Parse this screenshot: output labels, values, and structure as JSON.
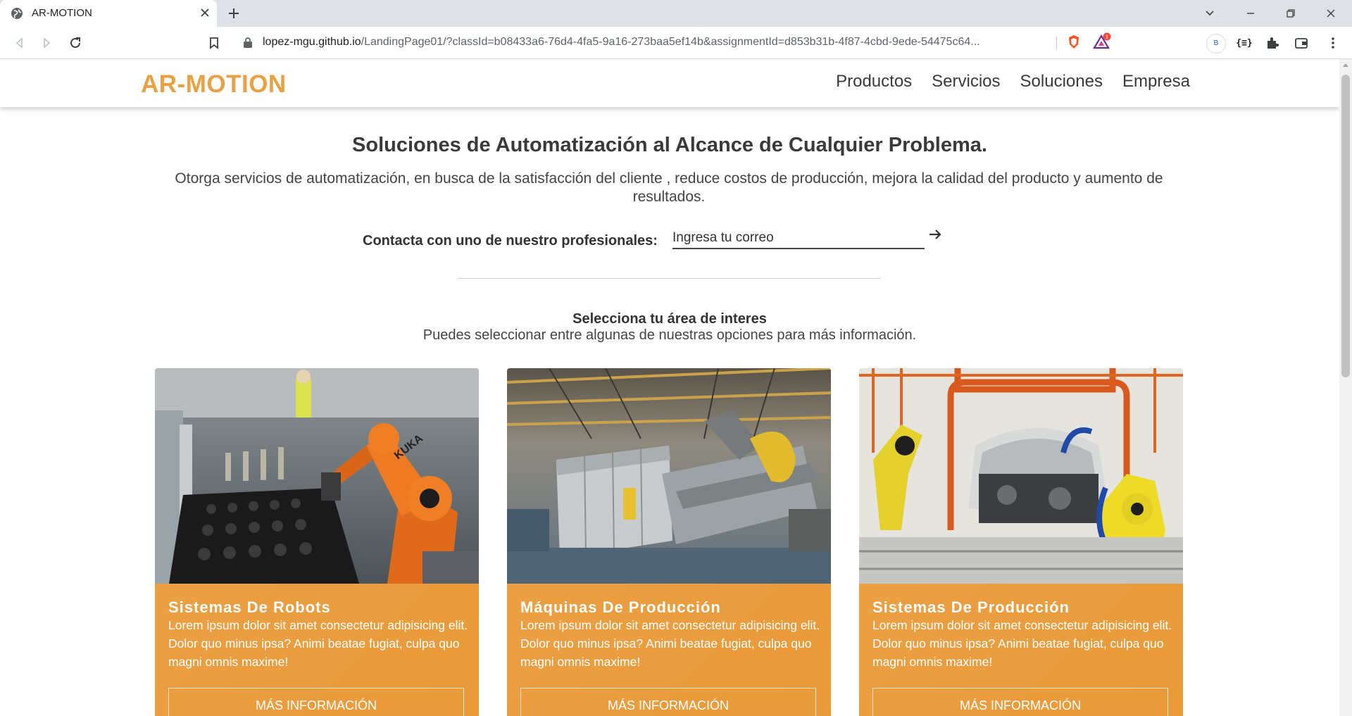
{
  "browser": {
    "tab_title": "AR-MOTION",
    "url_host": "lopez-mgu.github.io",
    "url_rest": "/LandingPage01/?classId=b08433a6-76d4-4fa5-9a16-273baa5ef14b&assignmentId=d853b31b-4f87-4cbd-9ede-54475c64...",
    "profile_initial": "B",
    "brave_badge": "1"
  },
  "header": {
    "logo": "AR-MOTION",
    "nav": [
      "Productos",
      "Servicios",
      "Soluciones",
      "Empresa"
    ]
  },
  "hero": {
    "title": "Soluciones de Automatización al Alcance de Cualquier Problema.",
    "subtitle": "Otorga servicios de automatización, en busca de la satisfacción del cliente , reduce costos de producción, mejora la calidad del producto y aumento de resultados.",
    "contact_label": "Contacta con uno de nuestro profesionales:",
    "email_placeholder": "Ingresa tu correo"
  },
  "section": {
    "title": "Selecciona tu área de interes",
    "subtitle": "Puedes seleccionar entre algunas de nuestras opciones para más información."
  },
  "cards": [
    {
      "title": "Sistemas De Robots",
      "text": "Lorem ipsum dolor sit amet consectetur adipisicing elit. Dolor quo minus ipsa? Animi beatae fugiat, culpa quo magni omnis maxime!",
      "button": "MÁS INFORMACIÓN",
      "image": "orange-kuka-robot-arm-photo"
    },
    {
      "title": "Máquinas De Producción",
      "text": "Lorem ipsum dolor sit amet consectetur adipisicing elit. Dolor quo minus ipsa? Animi beatae fugiat, culpa quo magni omnis maxime!",
      "button": "MÁS INFORMACIÓN",
      "image": "industrial-production-machine-photo"
    },
    {
      "title": "Sistemas De Producción",
      "text": "Lorem ipsum dolor sit amet consectetur adipisicing elit. Dolor quo minus ipsa? Animi beatae fugiat, culpa quo magni omnis maxime!",
      "button": "MÁS INFORMACIÓN",
      "image": "car-assembly-line-robots-photo"
    }
  ],
  "colors": {
    "brand": "#e8a145",
    "card_background": "#eba048",
    "text": "#333333"
  }
}
